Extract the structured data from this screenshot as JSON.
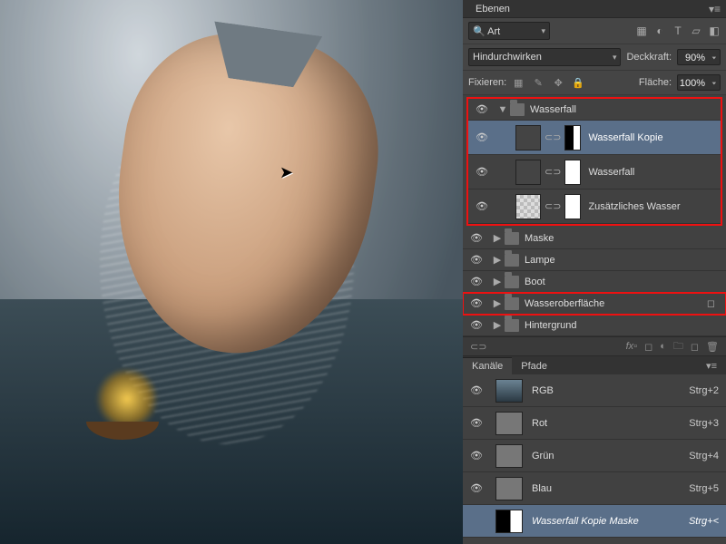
{
  "layers_panel": {
    "title": "Ebenen",
    "search_mode": "Art",
    "blend_mode": "Hindurchwirken",
    "opacity_label": "Deckkraft:",
    "opacity_value": "90%",
    "lock_label": "Fixieren:",
    "fill_label": "Fläche:",
    "fill_value": "100%",
    "groups": [
      {
        "name": "Wasserfall",
        "open": true,
        "highlight": true,
        "layers": [
          {
            "name": "Wasserfall Kopie",
            "selected": true,
            "mask": "dark"
          },
          {
            "name": "Wasserfall",
            "mask": "white"
          },
          {
            "name": "Zusätzliches Wasser",
            "checker": true,
            "mask": "white"
          }
        ]
      },
      {
        "name": "Maske"
      },
      {
        "name": "Lampe"
      },
      {
        "name": "Boot"
      },
      {
        "name": "Wasseroberfläche",
        "highlight_single": true,
        "dup": true
      },
      {
        "name": "Hintergrund"
      }
    ]
  },
  "channels_panel": {
    "tab1": "Kanäle",
    "tab2": "Pfade",
    "items": [
      {
        "name": "RGB",
        "shortcut": "Strg+2",
        "type": "rgb"
      },
      {
        "name": "Rot",
        "shortcut": "Strg+3"
      },
      {
        "name": "Grün",
        "shortcut": "Strg+4"
      },
      {
        "name": "Blau",
        "shortcut": "Strg+5"
      },
      {
        "name": "Wasserfall Kopie Maske",
        "shortcut": "Strg+<",
        "selected": true,
        "last": true
      }
    ]
  }
}
